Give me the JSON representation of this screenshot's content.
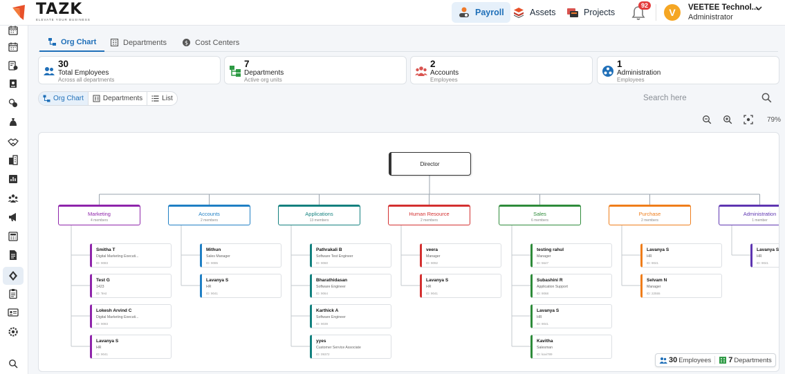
{
  "brand": {
    "name": "TAZK",
    "tagline": "ELEVATE YOUR BUSINESS"
  },
  "topnav": [
    {
      "label": "Payroll",
      "icon": "payroll-icon",
      "active": true
    },
    {
      "label": "Assets",
      "icon": "assets-icon",
      "active": false
    },
    {
      "label": "Projects",
      "icon": "projects-icon",
      "active": false
    }
  ],
  "notifications": {
    "count": "92"
  },
  "user": {
    "initial": "V",
    "name": "VEETEE Technol...",
    "role": "Administrator"
  },
  "sidebar_icons": [
    "calendar-icon",
    "calendar-icon",
    "money-icon",
    "id-badge-icon",
    "coins-icon",
    "money-bag-icon",
    "handshake-icon",
    "building-icon",
    "bar-chart-icon",
    "team-icon",
    "megaphone-icon",
    "calculator-icon",
    "document-icon",
    "org-chart-icon",
    "clipboard-icon",
    "id-card-icon",
    "settings-icon",
    "search-icon"
  ],
  "tabs": [
    {
      "label": "Org Chart",
      "active": true
    },
    {
      "label": "Departments",
      "active": false
    },
    {
      "label": "Cost Centers",
      "active": false
    }
  ],
  "stats": [
    {
      "value": "30",
      "label": "Total Employees",
      "sub": "Across all departments",
      "icon": "users-icon",
      "color": "#1f6fb8"
    },
    {
      "value": "7",
      "label": "Departments",
      "sub": "Active org units",
      "icon": "org-units-icon",
      "color": "#2e9a45"
    },
    {
      "value": "2",
      "label": "Accounts",
      "sub": "Employees",
      "icon": "group-icon",
      "color": "#d9534f"
    },
    {
      "value": "1",
      "label": "Administration",
      "sub": "Employees",
      "icon": "network-icon",
      "color": "#1f6fb8"
    }
  ],
  "views": [
    {
      "label": "Org Chart",
      "active": true
    },
    {
      "label": "Departments",
      "active": false
    },
    {
      "label": "List",
      "active": false
    }
  ],
  "search": {
    "placeholder": "Search here"
  },
  "zoom": {
    "level": "79%"
  },
  "org": {
    "root": "Director",
    "departments": [
      {
        "name": "Marketing",
        "count": "4 members",
        "color": "#8e24aa",
        "employees": [
          {
            "name": "Smitha T",
            "role": "Digital Marketing Executi...",
            "id": "ID: 9083"
          },
          {
            "name": "Test G",
            "role": "1423",
            "id": "ID: Test"
          },
          {
            "name": "Lokesh Arvind C",
            "role": "Digital Marketing Executi...",
            "id": "ID: 9083"
          },
          {
            "name": "Lavanya S",
            "role": "HR",
            "id": "ID: 9041"
          }
        ]
      },
      {
        "name": "Accounts",
        "count": "2 members",
        "color": "#1f7fc4",
        "employees": [
          {
            "name": "Mithun",
            "role": "Sales Manager",
            "id": "ID: 9085"
          },
          {
            "name": "Lavanya S",
            "role": "HR",
            "id": "ID: 9041"
          }
        ]
      },
      {
        "name": "Applications",
        "count": "13 members",
        "color": "#12807e",
        "employees": [
          {
            "name": "Pathrakali B",
            "role": "Software Test Engineer",
            "id": "ID: 9060"
          },
          {
            "name": "Bharathidasan",
            "role": "Software Engineer",
            "id": "ID: 9064"
          },
          {
            "name": "Karthick A",
            "role": "Software Engineer",
            "id": "ID: 9039"
          },
          {
            "name": "yyes",
            "role": "Customer Service Associate",
            "id": "ID: 09372"
          }
        ]
      },
      {
        "name": "Human Resource",
        "count": "2 members",
        "color": "#d32f2f",
        "employees": [
          {
            "name": "veera",
            "role": "Manager",
            "id": "ID: 9092"
          },
          {
            "name": "Lavanya S",
            "role": "HR",
            "id": "ID: 9041"
          }
        ]
      },
      {
        "name": "Sales",
        "count": "6 members",
        "color": "#2e8b3a",
        "employees": [
          {
            "name": "testing rahul",
            "role": "Manager",
            "id": "ID: 5647"
          },
          {
            "name": "Subashini R",
            "role": "Application Support",
            "id": "ID: 9068"
          },
          {
            "name": "Lavanya S",
            "role": "HR",
            "id": "ID: 9041"
          },
          {
            "name": "Kavitha",
            "role": "Salesman",
            "id": "ID: kavi789"
          }
        ]
      },
      {
        "name": "Purchase",
        "count": "2 members",
        "color": "#ef7d1a",
        "employees": [
          {
            "name": "Lavanya S",
            "role": "HR",
            "id": "ID: 9041"
          },
          {
            "name": "Selvam N",
            "role": "Manager",
            "id": "ID: 22555"
          }
        ]
      },
      {
        "name": "Administration",
        "count": "1 member",
        "color": "#5e35b1",
        "employees": [
          {
            "name": "Lavanya S",
            "role": "HR",
            "id": "ID: 9041"
          }
        ]
      }
    ]
  },
  "summary": {
    "employees_value": "30",
    "employees_label": "Employees",
    "departments_value": "7",
    "departments_label": "Departments"
  }
}
